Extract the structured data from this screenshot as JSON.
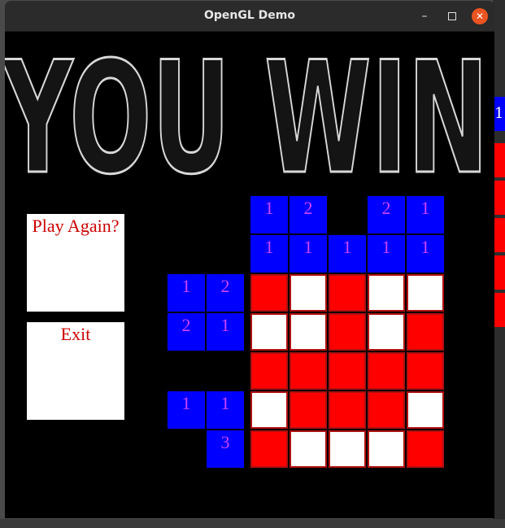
{
  "window": {
    "title": "OpenGL Demo",
    "minimize_icon": "minimize-icon",
    "maximize_icon": "maximize-icon",
    "close_icon": "close-icon"
  },
  "banner": {
    "text": "YOU WIN"
  },
  "menu": {
    "play_again_label": "Play Again?",
    "exit_label": "Exit"
  },
  "peek": {
    "label": "1"
  },
  "colors": {
    "clue_bg": "#0000ff",
    "clue_text": "#cc44ff",
    "filled": "#ff0000",
    "empty": "#ffffff",
    "button_text": "#cc0000"
  },
  "column_clues": [
    [
      "1",
      "2",
      "",
      "2",
      "1"
    ],
    [
      "1",
      "1",
      "1",
      "1",
      "1"
    ]
  ],
  "row_clues": [
    [
      "1",
      "2"
    ],
    [
      "2",
      "1"
    ],
    [
      "",
      ""
    ],
    [
      "1",
      "1"
    ],
    [
      "",
      "3"
    ]
  ],
  "grid": [
    [
      1,
      0,
      1,
      0,
      0
    ],
    [
      0,
      0,
      1,
      0,
      1
    ],
    [
      1,
      1,
      1,
      1,
      1
    ],
    [
      0,
      1,
      1,
      1,
      0
    ],
    [
      1,
      0,
      0,
      0,
      1
    ]
  ]
}
